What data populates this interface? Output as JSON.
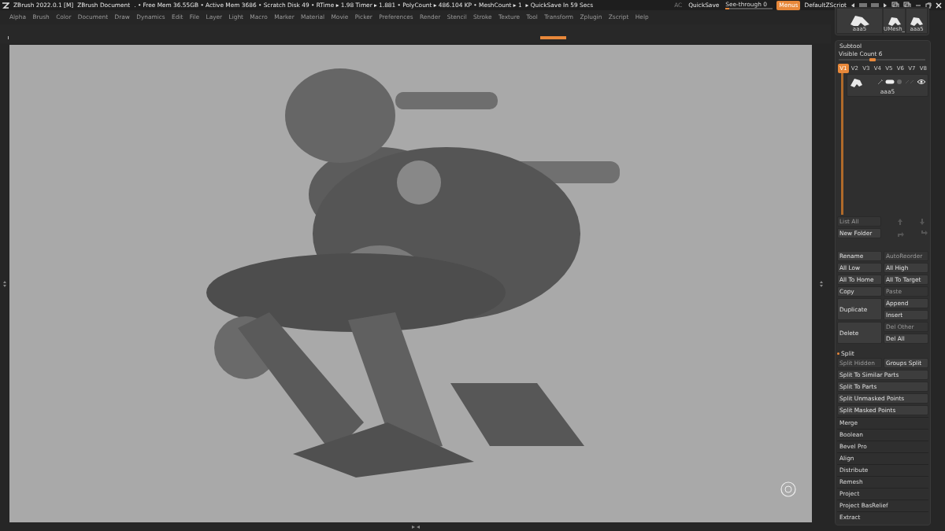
{
  "title_bar": {
    "app": "ZBrush 2022.0.1 [M]",
    "document": "ZBrush Document",
    "stats": ". • Free Mem 36.55GB • Active Mem 3686 • Scratch Disk 49 • RTime ▸ 1.98 Timer ▸ 1.881 • PolyCount ▸ 486.104 KP • MeshCount ▸ 1",
    "quicksave_timer": "▸ QuickSave In 59 Secs",
    "ac": "AC",
    "quicksave": "QuickSave",
    "see_through": {
      "label": "See-through",
      "value": "0",
      "level": 0.08
    },
    "menus": {
      "label": "Menus",
      "on": true
    },
    "script": "DefaultZScript"
  },
  "menu": [
    "Alpha",
    "Brush",
    "Color",
    "Document",
    "Draw",
    "Dynamics",
    "Edit",
    "File",
    "Layer",
    "Light",
    "Macro",
    "Marker",
    "Material",
    "Movie",
    "Picker",
    "Preferences",
    "Render",
    "Stencil",
    "Stroke",
    "Texture",
    "Tool",
    "Transform",
    "Zplugin",
    "Zscript",
    "Help"
  ],
  "tool_thumbnails": [
    {
      "label": "aaa5",
      "kind": "large"
    },
    {
      "label": "UMesh_",
      "kind": "small"
    },
    {
      "label": "aaa5",
      "kind": "small"
    }
  ],
  "subtool": {
    "title": "Subtool",
    "visible_count": {
      "label": "Visible Count 6",
      "level": 0.35
    },
    "versions": [
      {
        "label": "V1",
        "selected": true
      },
      {
        "label": "V2",
        "selected": false
      },
      {
        "label": "V3",
        "selected": false
      },
      {
        "label": "V4",
        "selected": false
      },
      {
        "label": "V5",
        "selected": false
      },
      {
        "label": "V6",
        "selected": false
      },
      {
        "label": "V7",
        "selected": false
      },
      {
        "label": "V8",
        "selected": false
      }
    ],
    "items": [
      {
        "name": "aaa5",
        "visible": true
      }
    ],
    "list_buttons": [
      {
        "label": "List All",
        "disabled": true
      },
      {
        "label": "New Folder",
        "disabled": false
      }
    ],
    "action_rows": [
      {
        "left": {
          "label": "Rename",
          "disabled": false
        },
        "right": [
          {
            "label": "AutoReorder",
            "disabled": true
          }
        ]
      },
      {
        "left": {
          "label": "All Low",
          "disabled": false
        },
        "right": [
          {
            "label": "All High",
            "disabled": false
          }
        ]
      },
      {
        "left": {
          "label": "All To Home",
          "disabled": false
        },
        "right": [
          {
            "label": "All To Target",
            "disabled": false
          }
        ]
      },
      {
        "left": {
          "label": "Copy",
          "disabled": false
        },
        "right": [
          {
            "label": "Paste",
            "disabled": true
          }
        ]
      },
      {
        "left": {
          "label": "Duplicate",
          "disabled": false
        },
        "right": [
          {
            "label": "Append",
            "disabled": false
          },
          {
            "label": "Insert",
            "disabled": false
          }
        ]
      },
      {
        "left": {
          "label": "Delete",
          "disabled": false
        },
        "right": [
          {
            "label": "Del Other",
            "disabled": true
          },
          {
            "label": "Del All",
            "disabled": false
          }
        ]
      }
    ],
    "split": {
      "title": "Split",
      "expanded": true,
      "buttons": [
        {
          "label": "Split Hidden",
          "disabled": true,
          "kind": "half"
        },
        {
          "label": "Groups Split",
          "disabled": false,
          "kind": "half"
        },
        {
          "label": "Split To Similar Parts",
          "disabled": false,
          "kind": "full"
        },
        {
          "label": "Split To Parts",
          "disabled": false,
          "kind": "full"
        },
        {
          "label": "Split Unmasked Points",
          "disabled": false,
          "kind": "full"
        },
        {
          "label": "Split Masked Points",
          "disabled": false,
          "kind": "full"
        }
      ]
    },
    "sections": [
      "Merge",
      "Boolean",
      "Bevel Pro",
      "Align",
      "Distribute",
      "Remesh",
      "Project",
      "Project BasRelief",
      "Extract"
    ]
  }
}
